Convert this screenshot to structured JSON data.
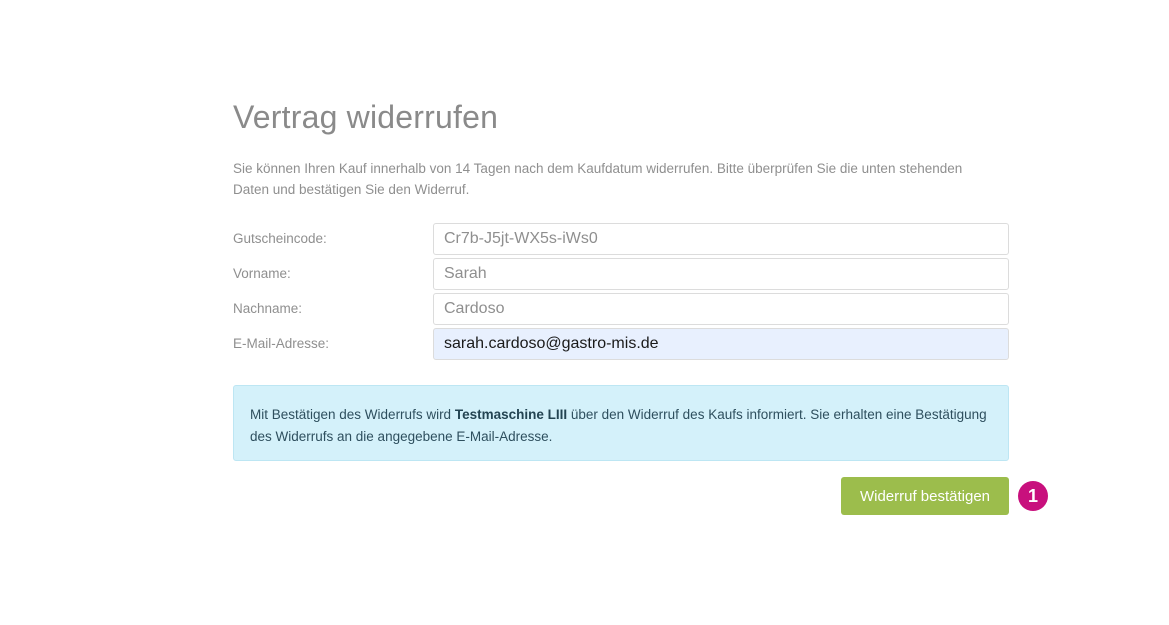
{
  "page": {
    "title": "Vertrag widerrufen",
    "intro": "Sie können Ihren Kauf innerhalb von 14 Tagen nach dem Kaufdatum widerrufen. Bitte überprüfen Sie die unten stehenden Daten und bestätigen Sie den Widerruf."
  },
  "form": {
    "fields": [
      {
        "label": "Gutscheincode:",
        "value": "Cr7b-J5jt-WX5s-iWs0"
      },
      {
        "label": "Vorname:",
        "value": "Sarah"
      },
      {
        "label": "Nachname:",
        "value": "Cardoso"
      },
      {
        "label": "E-Mail-Adresse:",
        "value": "sarah.cardoso@gastro-mis.de"
      }
    ]
  },
  "info": {
    "text_before": "Mit Bestätigen des Widerrufs wird ",
    "merchant": "Testmaschine LIII",
    "text_after": " über den Widerruf des Kaufs informiert. Sie erhalten eine Bestätigung des Widerrufs an die angegebene E-Mail-Adresse."
  },
  "actions": {
    "confirm_label": "Widerruf bestätigen",
    "step_number": "1"
  },
  "colors": {
    "title": "#8a8a8a",
    "button": "#9cbd4c",
    "info_background": "#d4f1fa",
    "step_badge": "#c8107d",
    "autofill_background": "#e8f0fe"
  }
}
